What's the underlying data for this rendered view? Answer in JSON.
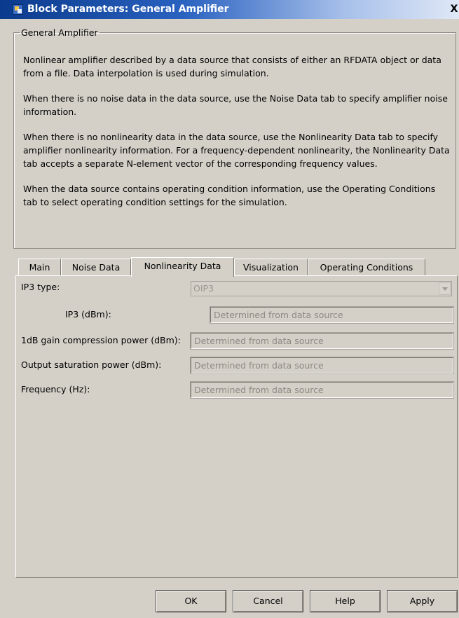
{
  "window": {
    "title": "Block Parameters: General Amplifier",
    "close_label": "X"
  },
  "group": {
    "legend": "General Amplifier",
    "paragraphs": [
      "Nonlinear amplifier described by a data source that consists of either an RFDATA object or data from a file. Data interpolation is used during simulation.",
      "When there is no noise data in the data source, use the Noise Data tab to specify amplifier noise information.",
      "When there is no nonlinearity data in the data source, use the Nonlinearity Data tab to specify amplifier nonlinearity information. For a frequency-dependent nonlinearity, the Nonlinearity Data tab accepts a separate N-element vector of the corresponding frequency values.",
      "When the data source contains operating condition information, use the Operating Conditions tab to select operating condition settings for the simulation."
    ]
  },
  "tabs": [
    {
      "label": "Main"
    },
    {
      "label": "Noise Data"
    },
    {
      "label": "Nonlinearity Data",
      "active": true
    },
    {
      "label": "Visualization"
    },
    {
      "label": "Operating Conditions"
    }
  ],
  "form": {
    "ip3_type_label": "IP3 type:",
    "ip3_type_value": "OIP3",
    "ip3_label": "IP3 (dBm):",
    "ip3_value": "Determined from data source",
    "p1db_label": "1dB gain compression power (dBm):",
    "p1db_value": "Determined from data source",
    "psat_label": "Output saturation power (dBm):",
    "psat_value": "Determined from data source",
    "freq_label": "Frequency (Hz):",
    "freq_value": "Determined from data source"
  },
  "buttons": {
    "ok": "OK",
    "cancel": "Cancel",
    "help": "Help",
    "apply": "Apply"
  },
  "colors": {
    "dialog_bg": "#d4d0c8",
    "titlebar_start": "#0a3a8c",
    "disabled_text": "#8e8a83"
  }
}
